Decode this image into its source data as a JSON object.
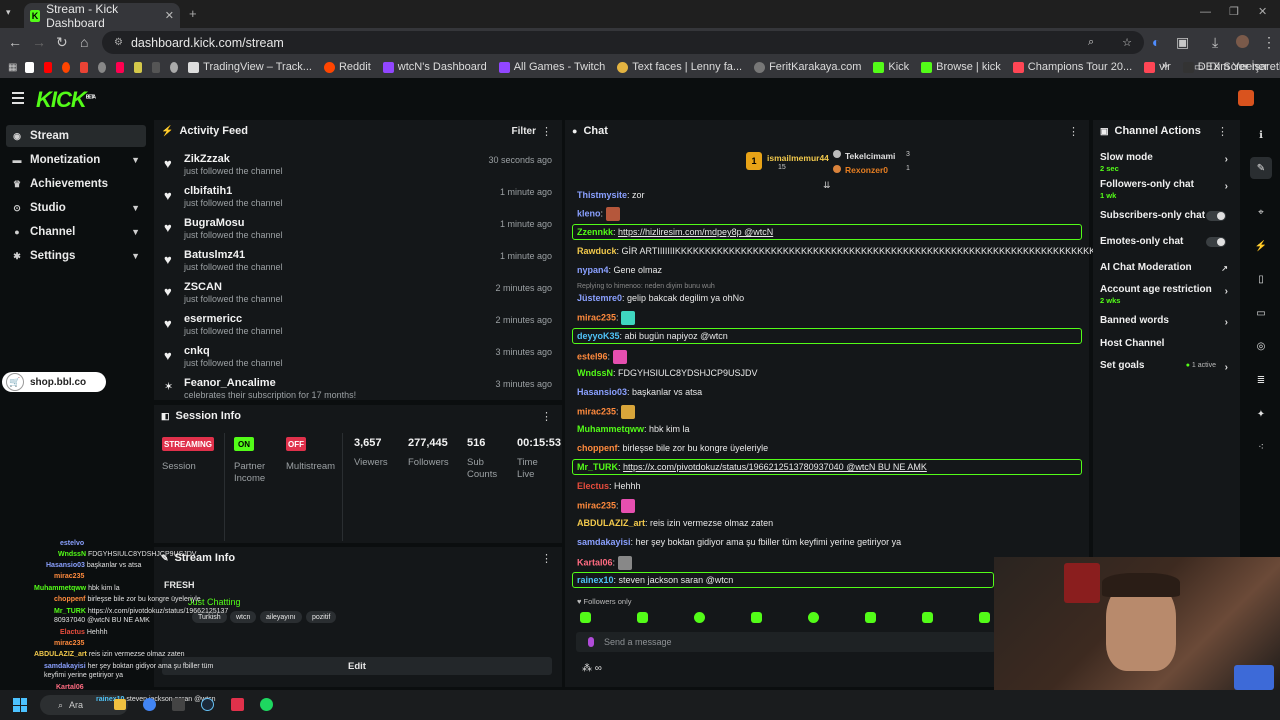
{
  "browser": {
    "tab_title": "Stream - Kick Dashboard",
    "url": "dashboard.kick.com/stream",
    "bookmarks": [
      "TradingView – Track...",
      "Reddit",
      "wtcN's Dashboard",
      "All Games - Twitch",
      "Text faces | Lenny fa...",
      "FeritKarakaya.com",
      "Kick",
      "Browse | kick",
      "Champions Tour 20...",
      "vlr",
      "DEX Screener"
    ],
    "all_bookmarks": "Tüm Yer İşaretleri"
  },
  "brand": {
    "logo": "KICK",
    "beta": "BETA",
    "accent": "#53fc18"
  },
  "sidebar": {
    "items": [
      {
        "label": "Stream",
        "icon": "broadcast-icon",
        "active": true
      },
      {
        "label": "Monetization",
        "icon": "money-icon"
      },
      {
        "label": "Achievements",
        "icon": "trophy-icon"
      },
      {
        "label": "Studio",
        "icon": "studio-icon"
      },
      {
        "label": "Channel",
        "icon": "user-icon"
      },
      {
        "label": "Settings",
        "icon": "gear-icon"
      }
    ],
    "shop_link": "shop.bbl.co"
  },
  "activity": {
    "title": "Activity Feed",
    "filter": "Filter",
    "items": [
      {
        "name": "ZikZzzak",
        "desc": "just followed the channel",
        "time": "30 seconds ago"
      },
      {
        "name": "clbifatih1",
        "desc": "just followed the channel",
        "time": "1 minute ago"
      },
      {
        "name": "BugraMosu",
        "desc": "just followed the channel",
        "time": "1 minute ago"
      },
      {
        "name": "Batuslmz41",
        "desc": "just followed the channel",
        "time": "1 minute ago"
      },
      {
        "name": "ZSCAN",
        "desc": "just followed the channel",
        "time": "2 minutes ago"
      },
      {
        "name": "esermericc",
        "desc": "just followed the channel",
        "time": "2 minutes ago"
      },
      {
        "name": "cnkq",
        "desc": "just followed the channel",
        "time": "3 minutes ago"
      },
      {
        "name": "Feanor_Ancalime",
        "desc": "celebrates their subscription for 17 months!",
        "time": "3 minutes ago"
      }
    ]
  },
  "session": {
    "title": "Session Info",
    "streaming_badge": "STREAMING",
    "session_label": "Session",
    "partner_badge": "ON",
    "partner_label": "Partner Income",
    "multistream_badge": "OFF",
    "multistream_label": "Multistream",
    "viewers": "3,657",
    "viewers_label": "Viewers",
    "followers": "277,445",
    "followers_label": "Followers",
    "subs": "516",
    "subs_label": "Sub Counts",
    "time": "00:15:53",
    "time_label": "Time Live"
  },
  "stream_info": {
    "title": "Stream Info",
    "stream_title": "FRESH",
    "category": "Just Chatting",
    "tags": [
      "Turkish",
      "wtcn",
      "aileyayını",
      "pozitif"
    ],
    "edit": "Edit"
  },
  "chat": {
    "title": "Chat",
    "top_gifters": [
      {
        "name": "ismailmemur44",
        "count": "15"
      },
      {
        "name": "Tekelcimami",
        "count": "3"
      },
      {
        "name": "Rexonzer0",
        "count": "1"
      }
    ],
    "messages": [
      {
        "user": "Thistmysite",
        "text": "zor",
        "color": "#8aa0ff"
      },
      {
        "user": "kleno",
        "text": "",
        "color": "#8aa0ff"
      },
      {
        "user": "Zzennkk",
        "text": "https://hizliresim.com/mdpey8p @wtcN",
        "color": "#53fc18",
        "hl": true
      },
      {
        "user": "Rawduck",
        "text": "GİR ARTIIIIIIIKKKKKKKKKKKKKKKKKKKKKKKKKKKKKKKKKKKKKKKKKKKKKKKKKKKKKKKKKKKKKKKKKKKKKKKKKK",
        "color": "#f2c94c"
      },
      {
        "user": "nypan4",
        "text": "Gene olmaz",
        "color": "#8aa0ff"
      },
      {
        "user": "Jüstemre0",
        "text": "gelip bakcak degilim ya ohNo",
        "reply": "Replying to himenoo: neden diyim bunu wuh",
        "color": "#8aa0ff"
      },
      {
        "user": "mirac235",
        "text": "",
        "color": "#ff8a3d"
      },
      {
        "user": "deyyoK35",
        "text": "abi bugün napiyoz @wtcn",
        "color": "#4fc3f7",
        "hl": true
      },
      {
        "user": "estel96",
        "text": "",
        "color": "#ff8a3d"
      },
      {
        "user": "WndssN",
        "text": "FDGYHSIULC8YDSHJCP9USJDV",
        "color": "#53fc18"
      },
      {
        "user": "Hasansio03",
        "text": "başkanlar vs atsa",
        "color": "#8aa0ff"
      },
      {
        "user": "mirac235",
        "text": "",
        "color": "#ff8a3d"
      },
      {
        "user": "Muhammetqww",
        "text": "hbk kim la",
        "color": "#53fc18"
      },
      {
        "user": "choppenf",
        "text": "birleşse bile zor bu kongre üyeleriyle",
        "color": "#ff8a3d"
      },
      {
        "user": "Mr_TURK",
        "text": "https://x.com/pivotdokuz/status/1966212513780937040 @wtcN BU NE AMK",
        "color": "#53fc18",
        "hl": true
      },
      {
        "user": "Electus",
        "text": "Hehhh",
        "color": "#e74c3c"
      },
      {
        "user": "mirac235",
        "text": "",
        "color": "#ff8a3d"
      },
      {
        "user": "ABDULAZIZ_art",
        "text": "reis izin vermezse olmaz zaten",
        "color": "#f2c94c"
      },
      {
        "user": "samdakayisi",
        "text": "her şey boktan gidiyor ama şu fbiller tüm keyfimi yerine getiriyor ya",
        "color": "#8aa0ff"
      },
      {
        "user": "Kartal06",
        "text": "",
        "color": "#ff6b81"
      },
      {
        "user": "rainex10",
        "text": "steven jackson saran @wtcn",
        "color": "#4fc3f7",
        "hl": true
      }
    ],
    "followers_only": "Followers only",
    "placeholder": "Send a message"
  },
  "channel_actions": {
    "title": "Channel Actions",
    "items": [
      {
        "label": "Slow mode",
        "sub": "2 sec",
        "type": "chevron"
      },
      {
        "label": "Followers-only chat",
        "sub": "1 wk",
        "type": "chevron"
      },
      {
        "label": "Subscribers-only chat",
        "type": "toggle"
      },
      {
        "label": "Emotes-only chat",
        "type": "toggle"
      },
      {
        "label": "AI Chat Moderation",
        "type": "external"
      },
      {
        "label": "Account age restriction",
        "sub": "2 wks",
        "type": "chevron"
      },
      {
        "label": "Banned words",
        "type": "chevron"
      },
      {
        "label": "Host Channel",
        "type": "none"
      },
      {
        "label": "Set goals",
        "badge": "1 active",
        "type": "chevron"
      }
    ]
  },
  "overlay_chat": [
    {
      "user": "estelvo",
      "text": ""
    },
    {
      "user": "WndssN",
      "text": "FDGYHSIULC8YDSHJCP9USJDV"
    },
    {
      "user": "Hasansio03",
      "text": "başkanlar vs atsa"
    },
    {
      "user": "mirac235",
      "text": ""
    },
    {
      "user": "Muhammetqww",
      "text": "hbk kim la"
    },
    {
      "user": "choppenf",
      "text": "birleşse bile zor bu kongre üyeleriyle"
    },
    {
      "user": "Mr_TURK",
      "text": "https://x.com/pivotdokuz/status/19662125137 80937040 @wtcN BU NE AMK"
    },
    {
      "user": "Elactus",
      "text": "Hehhh"
    },
    {
      "user": "mirac235",
      "text": ""
    },
    {
      "user": "ABDULAZIZ_art",
      "text": "reis izin vermezse olmaz zaten"
    },
    {
      "user": "samdakayisi",
      "text": "her şey boktan gidiyor ama şu fbiller tüm keyfimi yerine getiriyor ya"
    },
    {
      "user": "Kartal06",
      "text": ""
    },
    {
      "user": "rainex10",
      "text": "steven jackson saran @wtcn"
    }
  ],
  "taskbar": {
    "search": "Ara"
  }
}
